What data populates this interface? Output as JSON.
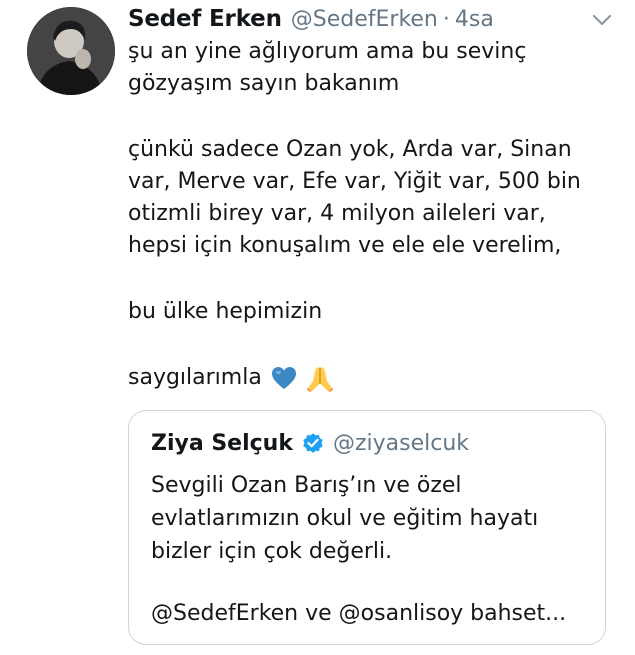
{
  "tweet": {
    "author_name": "Sedef Erken",
    "author_handle": "@SedefErken",
    "separator": "·",
    "time": "4sa",
    "text_lines": [
      "şu an yine ağlıyorum ama bu sevinç",
      "gözyaşım sayın bakanım",
      "",
      "çünkü sadece Ozan yok, Arda var, Sinan",
      "var, Merve var, Efe var, Yiğit var, 500 bin",
      "otizmli birey var, 4 milyon aileleri var,",
      "hepsi için konuşalım ve ele ele verelim,",
      "",
      "bu ülke hepimizin",
      "",
      "saygılarımla"
    ],
    "emojis": [
      "blue-heart",
      "folded-hands"
    ]
  },
  "quoted_tweet": {
    "author_name": "Ziya Selçuk",
    "author_handle": "@ziyaselcuk",
    "verified": true,
    "text_lines": [
      "Sevgili Ozan Barış’ın ve özel",
      "evlatlarımızın okul ve eğitim hayatı",
      "bizler için çok değerli.",
      "",
      "@SedefErken ve @osanlisoy bahset..."
    ]
  },
  "icons": {
    "menu": "chevron-down-icon",
    "verified": "verified-badge-icon"
  },
  "colors": {
    "text": "#14171a",
    "secondary": "#657786",
    "verified": "#1da1f2",
    "border": "#ccd6dd",
    "heart": "#3b88c3",
    "hands": "#ffcc4d"
  }
}
